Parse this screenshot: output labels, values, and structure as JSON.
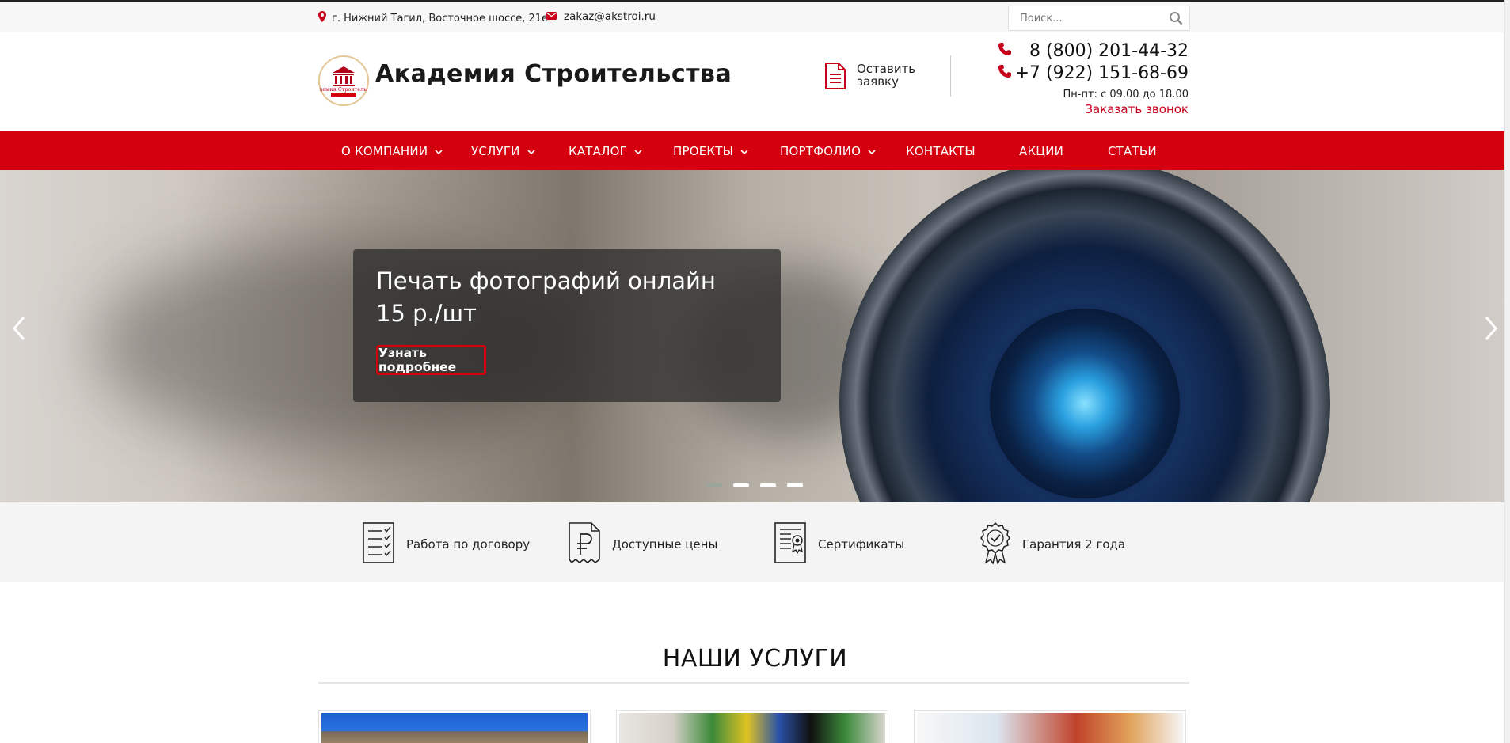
{
  "topbar": {
    "address": "г. Нижний Тагил, Восточное шоссе, 21е",
    "email": "zakaz@akstroi.ru",
    "search_placeholder": "Поиск..."
  },
  "header": {
    "logo_text": "Академия Строительства",
    "brand": "Академия Строительства",
    "request_line1": "Оставить",
    "request_line2": "заявку",
    "phone1": "8 (800) 201-44-32",
    "phone2": "+7 (922) 151-68-69",
    "hours": "Пн-пт: с 09.00 до 18.00",
    "callback": "Заказать звонок"
  },
  "nav": {
    "items": [
      {
        "label": "О КОМПАНИИ",
        "dropdown": true
      },
      {
        "label": "УСЛУГИ",
        "dropdown": true
      },
      {
        "label": "КАТАЛОГ",
        "dropdown": true
      },
      {
        "label": "ПРОЕКТЫ",
        "dropdown": true
      },
      {
        "label": "ПОРТФОЛИО",
        "dropdown": true
      },
      {
        "label": "КОНТАКТЫ",
        "dropdown": false
      },
      {
        "label": "АКЦИИ",
        "dropdown": false
      },
      {
        "label": "СТАТЬИ",
        "dropdown": false
      }
    ]
  },
  "hero": {
    "title_line1": "Печать фотографий онлайн",
    "title_line2": "15 р./шт",
    "button": "Узнать подробнее",
    "slides": 4,
    "active_slide": 1
  },
  "features": [
    {
      "label": "Работа по договору",
      "icon": "contract-icon"
    },
    {
      "label": "Доступные цены",
      "icon": "ruble-receipt-icon"
    },
    {
      "label": "Сертификаты",
      "icon": "certificate-icon"
    },
    {
      "label": "Гарантия 2 года",
      "icon": "guarantee-badge-icon"
    }
  ],
  "services": {
    "title": "НАШИ УСЛУГИ"
  },
  "colors": {
    "accent": "#d4000f",
    "topbar_bg": "#f7f7f7",
    "features_bg": "#f4f4f4"
  }
}
